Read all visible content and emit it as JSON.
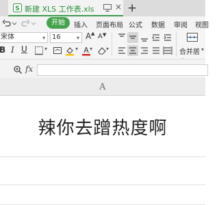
{
  "window": {
    "tab_title": "新建 XLS 工作表.xls",
    "close_glyph": "×",
    "new_tab_glyph": "+"
  },
  "menu": {
    "start": "开始",
    "insert": "插入",
    "page_layout": "页面布局",
    "formulas": "公式",
    "data": "数据",
    "review": "审阅",
    "view": "视图"
  },
  "ribbon": {
    "font_name": "宋体",
    "font_size": "16",
    "bold": "B",
    "italic": "I",
    "underline": "U",
    "grow_font": "A",
    "shrink_font": "A",
    "merge_label": "合并居中",
    "dropdown_arrow": "▾"
  },
  "formula_bar": {
    "fx": "fx",
    "value": ""
  },
  "sheet": {
    "column_a": "A",
    "cell_a1": "辣你去蹭热度啊"
  },
  "colors": {
    "accent_green": "#43a34a",
    "tab_title_green": "#27923b",
    "font_color_red": "#e02020",
    "fill_color_yellow": "#f5c400"
  }
}
